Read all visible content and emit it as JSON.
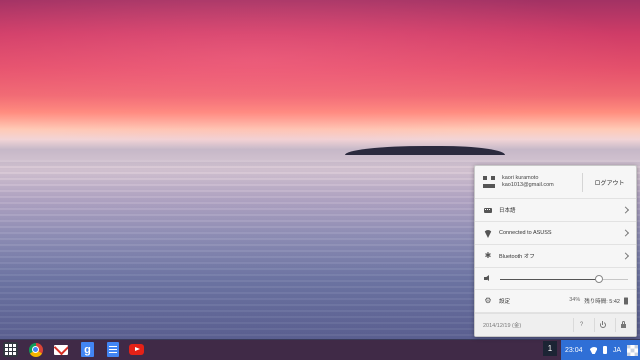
{
  "wallpaper": {
    "name": "sunset-lake-wallpaper"
  },
  "shelf": {
    "apps": [
      {
        "name": "launcher",
        "icon": "app-grid-icon"
      },
      {
        "name": "Chrome",
        "icon": "chrome-icon"
      },
      {
        "name": "Gmail",
        "icon": "gmail-icon"
      },
      {
        "name": "Google Search",
        "icon": "google-search-icon",
        "glyph": "g"
      },
      {
        "name": "Google Docs",
        "icon": "docs-icon"
      },
      {
        "name": "YouTube",
        "icon": "youtube-icon"
      }
    ],
    "notification_count": "1",
    "status": {
      "time": "23:04",
      "ime": "JA"
    }
  },
  "tray": {
    "user": {
      "name": "kaori kuramoto",
      "email": "kao1013@gmail.com",
      "logout_label": "ログアウト"
    },
    "ime_label": "日本語",
    "network_label": "Connected to ASUSS",
    "bluetooth_label": "Bluetooth オフ",
    "volume": {
      "level": 0.77
    },
    "settings_label": "設定",
    "battery": {
      "percent": "34%",
      "remaining": "残り時間: 5:42"
    },
    "date": "2014/12/19 (金)",
    "help_glyph": "?"
  },
  "colors": {
    "status_area": "#2f6fd6",
    "tray_bg": "#f6f6f6"
  }
}
